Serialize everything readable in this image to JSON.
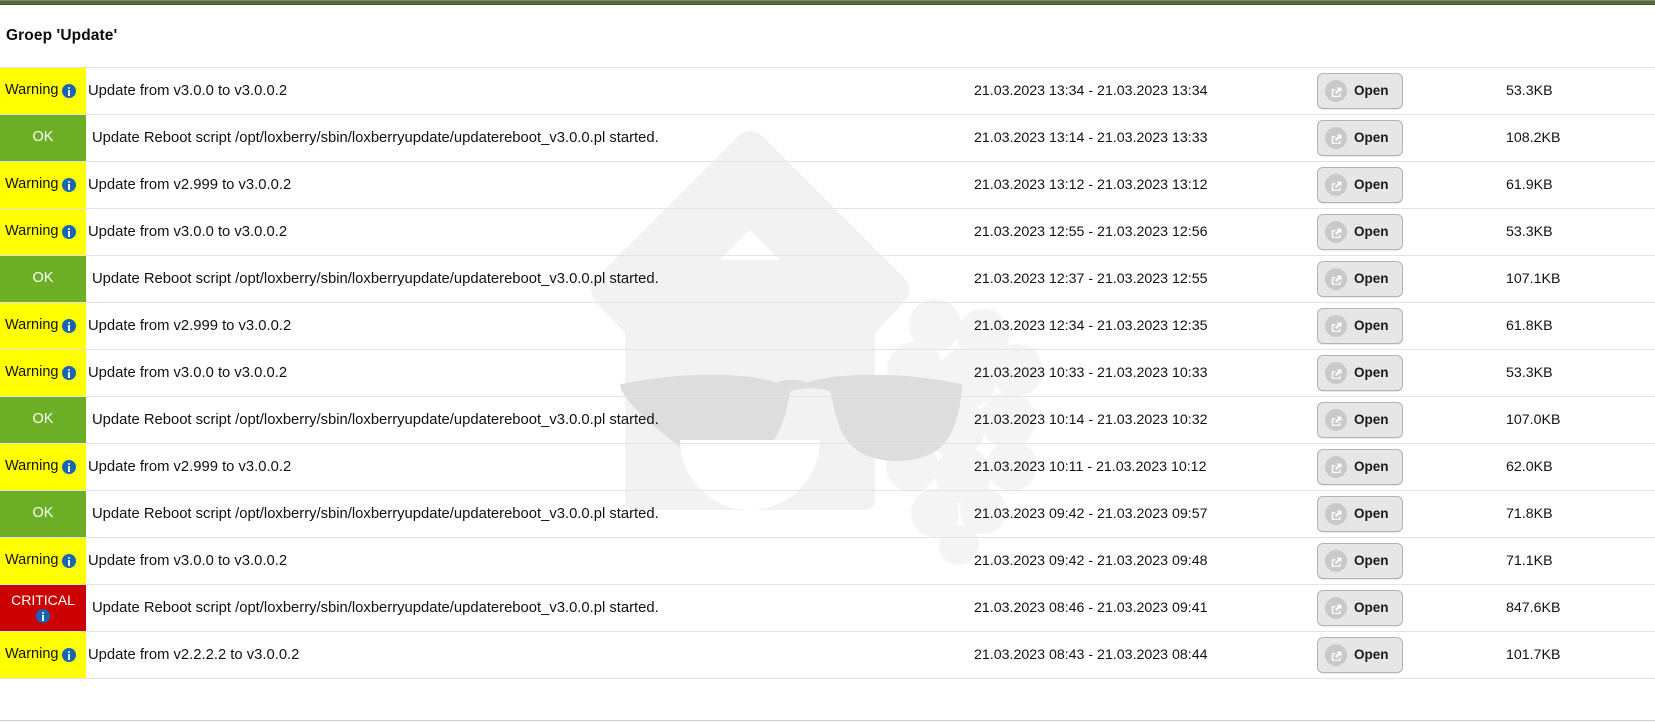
{
  "page": {
    "heading": "Groep 'Update'",
    "accent_top_color": "#596b41",
    "colors": {
      "warning_bg": "#ffff00",
      "ok_bg": "#6cae26",
      "critical_bg": "#cc0000",
      "info_icon_bg": "#1565b5",
      "button_bg": "#e6e6e6"
    }
  },
  "watermark": {
    "name": "loxberry-house-raspberry-watermark",
    "description": "house with sunglasses and smile next to a raspberry"
  },
  "table": {
    "open_button_label": "Open",
    "open_button_icon": "external-link-icon",
    "info_icon": "info-circle-icon",
    "rows": [
      {
        "status": "Warning",
        "status_kind": "warning",
        "has_info": true,
        "message": "Update from v3.0.0 to v3.0.0.2",
        "dates": "21.03.2023 13:34 - 21.03.2023 13:34",
        "open": "Open",
        "size": "53.3KB"
      },
      {
        "status": "OK",
        "status_kind": "ok",
        "has_info": false,
        "message": "Update Reboot script /opt/loxberry/sbin/loxberryupdate/updatereboot_v3.0.0.pl started.",
        "dates": "21.03.2023 13:14 - 21.03.2023 13:33",
        "open": "Open",
        "size": "108.2KB"
      },
      {
        "status": "Warning",
        "status_kind": "warning",
        "has_info": true,
        "message": "Update from v2.999 to v3.0.0.2",
        "dates": "21.03.2023 13:12 - 21.03.2023 13:12",
        "open": "Open",
        "size": "61.9KB"
      },
      {
        "status": "Warning",
        "status_kind": "warning",
        "has_info": true,
        "message": "Update from v3.0.0 to v3.0.0.2",
        "dates": "21.03.2023 12:55 - 21.03.2023 12:56",
        "open": "Open",
        "size": "53.3KB"
      },
      {
        "status": "OK",
        "status_kind": "ok",
        "has_info": false,
        "message": "Update Reboot script /opt/loxberry/sbin/loxberryupdate/updatereboot_v3.0.0.pl started.",
        "dates": "21.03.2023 12:37 - 21.03.2023 12:55",
        "open": "Open",
        "size": "107.1KB"
      },
      {
        "status": "Warning",
        "status_kind": "warning",
        "has_info": true,
        "message": "Update from v2.999 to v3.0.0.2",
        "dates": "21.03.2023 12:34 - 21.03.2023 12:35",
        "open": "Open",
        "size": "61.8KB"
      },
      {
        "status": "Warning",
        "status_kind": "warning",
        "has_info": true,
        "message": "Update from v3.0.0 to v3.0.0.2",
        "dates": "21.03.2023 10:33 - 21.03.2023 10:33",
        "open": "Open",
        "size": "53.3KB"
      },
      {
        "status": "OK",
        "status_kind": "ok",
        "has_info": false,
        "message": "Update Reboot script /opt/loxberry/sbin/loxberryupdate/updatereboot_v3.0.0.pl started.",
        "dates": "21.03.2023 10:14 - 21.03.2023 10:32",
        "open": "Open",
        "size": "107.0KB"
      },
      {
        "status": "Warning",
        "status_kind": "warning",
        "has_info": true,
        "message": "Update from v2.999 to v3.0.0.2",
        "dates": "21.03.2023 10:11 - 21.03.2023 10:12",
        "open": "Open",
        "size": "62.0KB"
      },
      {
        "status": "OK",
        "status_kind": "ok",
        "has_info": false,
        "message": "Update Reboot script /opt/loxberry/sbin/loxberryupdate/updatereboot_v3.0.0.pl started.",
        "dates": "21.03.2023 09:42 - 21.03.2023 09:57",
        "open": "Open",
        "size": "71.8KB"
      },
      {
        "status": "Warning",
        "status_kind": "warning",
        "has_info": true,
        "message": "Update from v3.0.0 to v3.0.0.2",
        "dates": "21.03.2023 09:42 - 21.03.2023 09:48",
        "open": "Open",
        "size": "71.1KB"
      },
      {
        "status": "CRITICAL",
        "status_kind": "critical",
        "has_info": true,
        "message": "Update Reboot script /opt/loxberry/sbin/loxberryupdate/updatereboot_v3.0.0.pl started.",
        "dates": "21.03.2023 08:46 - 21.03.2023 09:41",
        "open": "Open",
        "size": "847.6KB"
      },
      {
        "status": "Warning",
        "status_kind": "warning",
        "has_info": true,
        "message": "Update from v2.2.2.2 to v3.0.0.2",
        "dates": "21.03.2023 08:43 - 21.03.2023 08:44",
        "open": "Open",
        "size": "101.7KB"
      }
    ]
  }
}
